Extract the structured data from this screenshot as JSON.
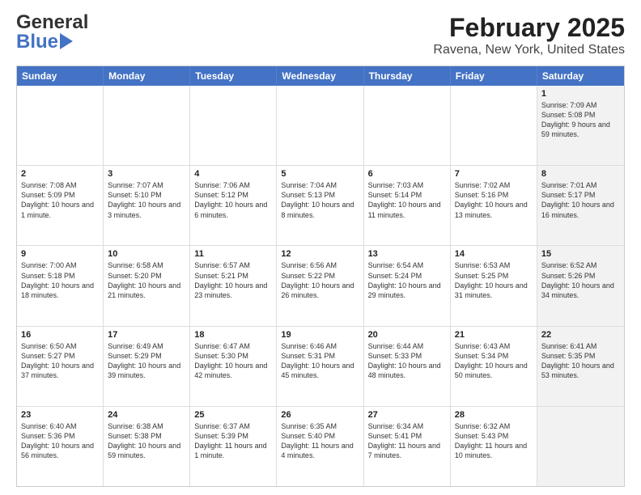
{
  "header": {
    "logo_general": "General",
    "logo_blue": "Blue",
    "title": "February 2025",
    "subtitle": "Ravena, New York, United States"
  },
  "days": [
    "Sunday",
    "Monday",
    "Tuesday",
    "Wednesday",
    "Thursday",
    "Friday",
    "Saturday"
  ],
  "weeks": [
    [
      {
        "num": "",
        "text": "",
        "shaded": false
      },
      {
        "num": "",
        "text": "",
        "shaded": false
      },
      {
        "num": "",
        "text": "",
        "shaded": false
      },
      {
        "num": "",
        "text": "",
        "shaded": false
      },
      {
        "num": "",
        "text": "",
        "shaded": false
      },
      {
        "num": "",
        "text": "",
        "shaded": false
      },
      {
        "num": "1",
        "text": "Sunrise: 7:09 AM\nSunset: 5:08 PM\nDaylight: 9 hours and 59 minutes.",
        "shaded": true
      }
    ],
    [
      {
        "num": "2",
        "text": "Sunrise: 7:08 AM\nSunset: 5:09 PM\nDaylight: 10 hours and 1 minute.",
        "shaded": false
      },
      {
        "num": "3",
        "text": "Sunrise: 7:07 AM\nSunset: 5:10 PM\nDaylight: 10 hours and 3 minutes.",
        "shaded": false
      },
      {
        "num": "4",
        "text": "Sunrise: 7:06 AM\nSunset: 5:12 PM\nDaylight: 10 hours and 6 minutes.",
        "shaded": false
      },
      {
        "num": "5",
        "text": "Sunrise: 7:04 AM\nSunset: 5:13 PM\nDaylight: 10 hours and 8 minutes.",
        "shaded": false
      },
      {
        "num": "6",
        "text": "Sunrise: 7:03 AM\nSunset: 5:14 PM\nDaylight: 10 hours and 11 minutes.",
        "shaded": false
      },
      {
        "num": "7",
        "text": "Sunrise: 7:02 AM\nSunset: 5:16 PM\nDaylight: 10 hours and 13 minutes.",
        "shaded": false
      },
      {
        "num": "8",
        "text": "Sunrise: 7:01 AM\nSunset: 5:17 PM\nDaylight: 10 hours and 16 minutes.",
        "shaded": true
      }
    ],
    [
      {
        "num": "9",
        "text": "Sunrise: 7:00 AM\nSunset: 5:18 PM\nDaylight: 10 hours and 18 minutes.",
        "shaded": false
      },
      {
        "num": "10",
        "text": "Sunrise: 6:58 AM\nSunset: 5:20 PM\nDaylight: 10 hours and 21 minutes.",
        "shaded": false
      },
      {
        "num": "11",
        "text": "Sunrise: 6:57 AM\nSunset: 5:21 PM\nDaylight: 10 hours and 23 minutes.",
        "shaded": false
      },
      {
        "num": "12",
        "text": "Sunrise: 6:56 AM\nSunset: 5:22 PM\nDaylight: 10 hours and 26 minutes.",
        "shaded": false
      },
      {
        "num": "13",
        "text": "Sunrise: 6:54 AM\nSunset: 5:24 PM\nDaylight: 10 hours and 29 minutes.",
        "shaded": false
      },
      {
        "num": "14",
        "text": "Sunrise: 6:53 AM\nSunset: 5:25 PM\nDaylight: 10 hours and 31 minutes.",
        "shaded": false
      },
      {
        "num": "15",
        "text": "Sunrise: 6:52 AM\nSunset: 5:26 PM\nDaylight: 10 hours and 34 minutes.",
        "shaded": true
      }
    ],
    [
      {
        "num": "16",
        "text": "Sunrise: 6:50 AM\nSunset: 5:27 PM\nDaylight: 10 hours and 37 minutes.",
        "shaded": false
      },
      {
        "num": "17",
        "text": "Sunrise: 6:49 AM\nSunset: 5:29 PM\nDaylight: 10 hours and 39 minutes.",
        "shaded": false
      },
      {
        "num": "18",
        "text": "Sunrise: 6:47 AM\nSunset: 5:30 PM\nDaylight: 10 hours and 42 minutes.",
        "shaded": false
      },
      {
        "num": "19",
        "text": "Sunrise: 6:46 AM\nSunset: 5:31 PM\nDaylight: 10 hours and 45 minutes.",
        "shaded": false
      },
      {
        "num": "20",
        "text": "Sunrise: 6:44 AM\nSunset: 5:33 PM\nDaylight: 10 hours and 48 minutes.",
        "shaded": false
      },
      {
        "num": "21",
        "text": "Sunrise: 6:43 AM\nSunset: 5:34 PM\nDaylight: 10 hours and 50 minutes.",
        "shaded": false
      },
      {
        "num": "22",
        "text": "Sunrise: 6:41 AM\nSunset: 5:35 PM\nDaylight: 10 hours and 53 minutes.",
        "shaded": true
      }
    ],
    [
      {
        "num": "23",
        "text": "Sunrise: 6:40 AM\nSunset: 5:36 PM\nDaylight: 10 hours and 56 minutes.",
        "shaded": false
      },
      {
        "num": "24",
        "text": "Sunrise: 6:38 AM\nSunset: 5:38 PM\nDaylight: 10 hours and 59 minutes.",
        "shaded": false
      },
      {
        "num": "25",
        "text": "Sunrise: 6:37 AM\nSunset: 5:39 PM\nDaylight: 11 hours and 1 minute.",
        "shaded": false
      },
      {
        "num": "26",
        "text": "Sunrise: 6:35 AM\nSunset: 5:40 PM\nDaylight: 11 hours and 4 minutes.",
        "shaded": false
      },
      {
        "num": "27",
        "text": "Sunrise: 6:34 AM\nSunset: 5:41 PM\nDaylight: 11 hours and 7 minutes.",
        "shaded": false
      },
      {
        "num": "28",
        "text": "Sunrise: 6:32 AM\nSunset: 5:43 PM\nDaylight: 11 hours and 10 minutes.",
        "shaded": false
      },
      {
        "num": "",
        "text": "",
        "shaded": true
      }
    ]
  ]
}
